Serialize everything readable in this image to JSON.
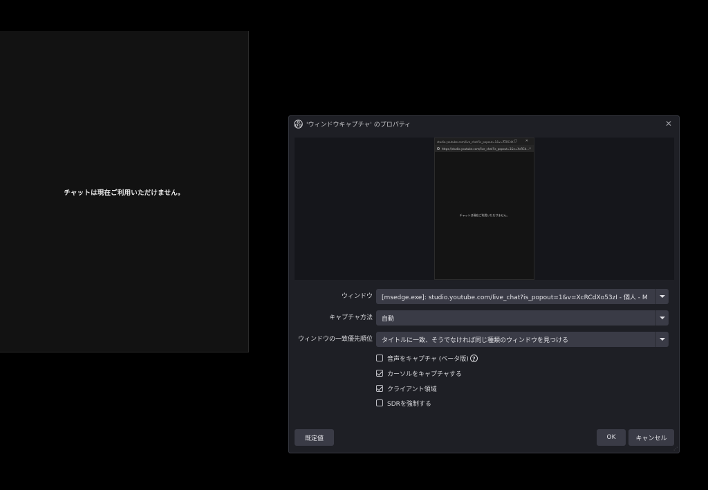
{
  "chat_panel": {
    "message": "チャットは現在ご利用いただけません。"
  },
  "dialog": {
    "title": "'ウィンドウキャプチャ' のプロパティ",
    "close_label": "✕",
    "preview": {
      "window_title": "studio.youtube.com/live_chat?is_popout=1&v=XcRCdX...",
      "controls": "— ▢ ✕",
      "url": "https://studio.youtube.com/live_chat?is_popout=1&v=XcRCd...",
      "message": "チャットは現在ご利用いただけません。"
    },
    "fields": {
      "window": {
        "label": "ウィンドウ",
        "value": "[msedge.exe]: studio.youtube.com/live_chat?is_popout=1&v=XcRCdXo53zI - 個人 - M"
      },
      "capture_method": {
        "label": "キャプチャ方法",
        "value": "自動"
      },
      "match_priority": {
        "label": "ウィンドウの一致優先順位",
        "value": "タイトルに一致、そうでなければ同じ種類のウィンドウを見つける"
      }
    },
    "checkboxes": {
      "audio": {
        "label": "音声をキャプチャ (ベータ版)",
        "checked": false,
        "help": "?"
      },
      "cursor": {
        "label": "カーソルをキャプチャする",
        "checked": true
      },
      "client_area": {
        "label": "クライアント領域",
        "checked": true
      },
      "force_sdr": {
        "label": "SDRを強制する",
        "checked": false
      }
    },
    "buttons": {
      "defaults": "既定値",
      "ok": "OK",
      "cancel": "キャンセル"
    }
  }
}
